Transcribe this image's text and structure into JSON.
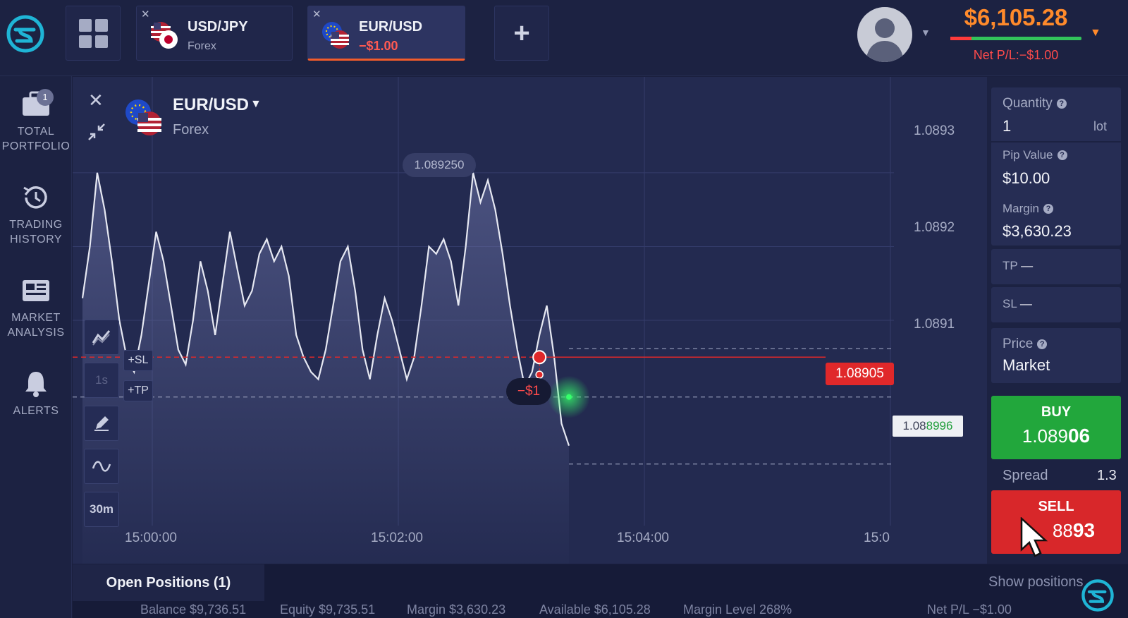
{
  "topbar": {
    "tabs": [
      {
        "name": "USD/JPY",
        "sub": "Forex",
        "close": "✕"
      },
      {
        "name": "EUR/USD",
        "sub": "−$1.00",
        "close": "✕"
      }
    ],
    "add_label": "+",
    "balance": "$6,105.28",
    "net_pl": "Net P/L:−$1.00"
  },
  "sidebar": {
    "items": [
      {
        "label1": "TOTAL",
        "label2": "PORTFOLIO",
        "badge": "1"
      },
      {
        "label1": "TRADING",
        "label2": "HISTORY"
      },
      {
        "label1": "MARKET",
        "label2": "ANALYSIS"
      },
      {
        "label1": "ALERTS",
        "label2": ""
      }
    ]
  },
  "chart": {
    "close_glyph": "✕",
    "asset": "EUR/USD",
    "asset_type": "Forex",
    "high_label": "1.089250",
    "entry_price": "1.08905",
    "current_price_main": "1.08",
    "current_price_green": "8996",
    "pl_badge": "−$1",
    "tools": {
      "interval_1s": "1s",
      "interval_30m": "30m",
      "sl": "+SL",
      "tp": "+TP"
    },
    "y_ticks": [
      "1.0893",
      "1.0892",
      "1.0891"
    ],
    "x_ticks": [
      "15:00:00",
      "15:02:00",
      "15:04:00",
      "15:0"
    ]
  },
  "chart_data": {
    "type": "line",
    "x_ticks": [
      "15:00:00",
      "15:02:00",
      "15:04:00",
      "15:0"
    ],
    "y_ticks": [
      1.0893,
      1.0892,
      1.0891
    ],
    "ylim": [
      1.08877,
      1.08943
    ],
    "series": [
      {
        "values": [
          1.08913,
          1.0892,
          1.0893,
          1.08925,
          1.08918,
          1.0891,
          1.08905,
          1.08903,
          1.08908,
          1.08915,
          1.08922,
          1.08918,
          1.08912,
          1.08906,
          1.08904,
          1.0891,
          1.08918,
          1.08914,
          1.08908,
          1.08915,
          1.08922,
          1.08917,
          1.08912,
          1.08914,
          1.08919,
          1.08921,
          1.08918,
          1.0892,
          1.08916,
          1.08908,
          1.08905,
          1.08903,
          1.08902,
          1.08906,
          1.08912,
          1.08918,
          1.0892,
          1.08914,
          1.08906,
          1.08902,
          1.08908,
          1.08913,
          1.0891,
          1.08906,
          1.08902,
          1.08905,
          1.08912,
          1.0892,
          1.08919,
          1.08921,
          1.08918,
          1.08912,
          1.0892,
          1.0893,
          1.08926,
          1.08929,
          1.08925,
          1.08919,
          1.08912,
          1.08906,
          1.08901,
          1.08903,
          1.08908,
          1.08912,
          1.08905,
          1.08896,
          1.08893
        ]
      }
    ],
    "entry_price": 1.08905,
    "current_price": 1.088996,
    "high_marker": 1.08925
  },
  "panel": {
    "quantity_label": "Quantity",
    "quantity_value": "1",
    "quantity_unit": "lot",
    "pip_label": "Pip Value",
    "pip_value": "$10.00",
    "margin_label": "Margin",
    "margin_value": "$3,630.23",
    "tp_label": "TP",
    "tp_value": "—",
    "sl_label": "SL",
    "sl_value": "—",
    "price_label": "Price",
    "price_value": "Market",
    "buy_label": "BUY",
    "buy_price_main": "1.089",
    "buy_price_bold": "06",
    "spread_label": "Spread",
    "spread_value": "1.3",
    "sell_label": "SELL",
    "sell_price_main": "88",
    "sell_price_bold": "93",
    "help_glyph": "?"
  },
  "bottom": {
    "open_positions": "Open Positions (1)",
    "show_positions": "Show positions",
    "status": [
      "Balance $9,736.51",
      "Equity $9,735.51",
      "Margin $3,630.23",
      "Available $6,105.28",
      "Margin Level 268%",
      "Net P/L −$1.00"
    ]
  },
  "colors": {
    "accent_orange": "#ff8a2b",
    "buy_green": "#22a73c",
    "sell_red": "#d8272a",
    "line": "#e6e8f2"
  }
}
